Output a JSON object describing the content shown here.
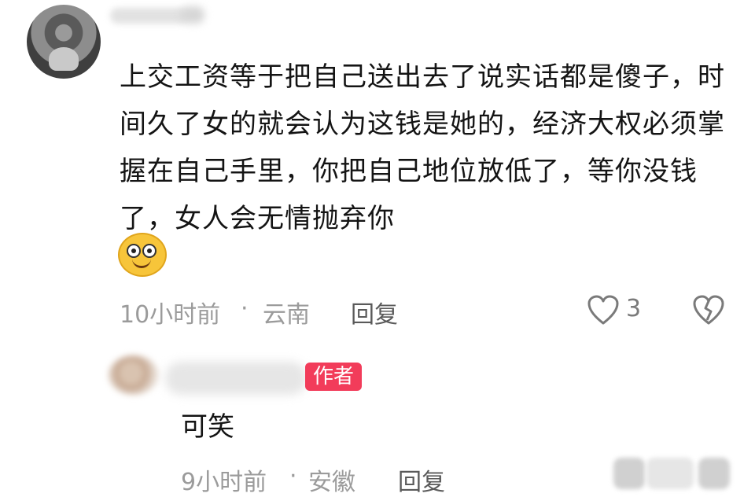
{
  "comment": {
    "text": "上交工资等于把自己送出去了说实话都是傻子，时间久了女的就会认为这钱是她的，经济大权必须掌握在自己手里，你把自己地位放低了，等你没钱了，女人会无情抛弃你",
    "emoji": "smiling-face-emoji",
    "time": "10小时前",
    "separator": "·",
    "location": "云南",
    "reply_label": "回复",
    "like_count": "3"
  },
  "reply": {
    "badge": "作者",
    "text": "可笑",
    "time": "9小时前",
    "separator": "·",
    "location": "安徽",
    "reply_label": "回复"
  },
  "colors": {
    "badge": "#f23c5a",
    "meta": "#9b9b9b",
    "text": "#141414"
  }
}
